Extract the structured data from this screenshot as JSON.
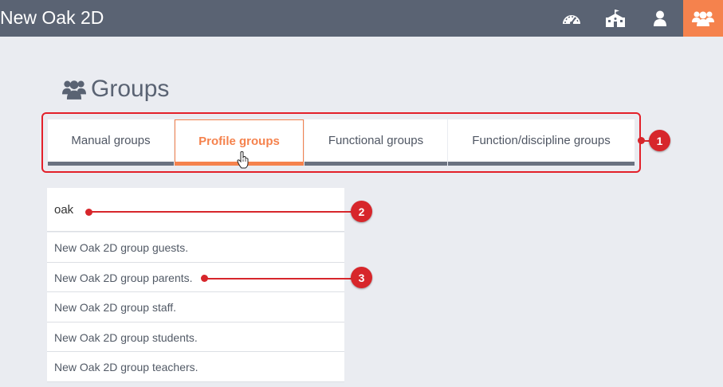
{
  "app": {
    "title": "New Oak 2D"
  },
  "topbar": {
    "icons": [
      "dashboard-icon",
      "school-icon",
      "user-icon",
      "groups-icon"
    ],
    "colors": {
      "bar": "#5a6373",
      "active": "#f5824d"
    }
  },
  "page": {
    "title": "Groups"
  },
  "tabs": [
    {
      "label": "Manual groups"
    },
    {
      "label": "Profile groups"
    },
    {
      "label": "Functional groups"
    },
    {
      "label": "Function/discipline groups"
    }
  ],
  "search": {
    "value": "oak"
  },
  "results": [
    "New Oak 2D group guests.",
    "New Oak 2D group parents.",
    "New Oak 2D group staff.",
    "New Oak 2D group students.",
    "New Oak 2D group teachers."
  ],
  "annotations": [
    "1",
    "2",
    "3"
  ],
  "colors": {
    "accent": "#f5824d",
    "annotation": "#d7262b"
  }
}
